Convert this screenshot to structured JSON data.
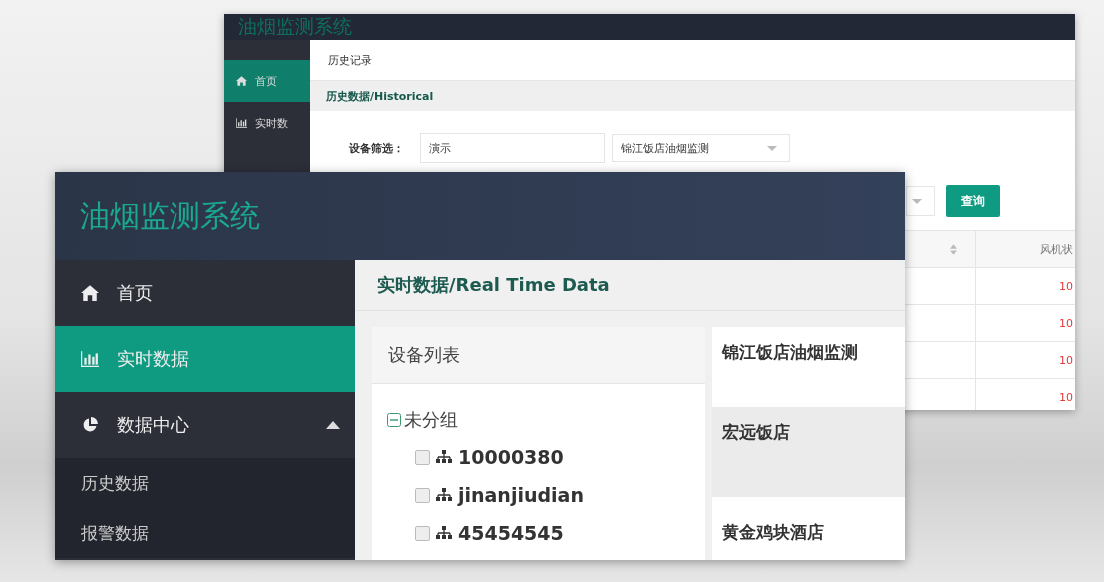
{
  "back_window": {
    "logo": "油烟监测系统",
    "nav": [
      {
        "label": "首页",
        "kind": "home",
        "selected": true
      },
      {
        "label": "实时数",
        "kind": "bars",
        "selected": false
      }
    ],
    "tab": "历史记录",
    "breadcrumb": "历史数据/Historical",
    "filter": {
      "label": "设备筛选：",
      "field_value": "演示",
      "select_value": "锦江饭店油烟监测"
    },
    "query_button": "查询",
    "table": {
      "column_2": "风机状",
      "rows": [
        "10",
        "10",
        "10",
        "10"
      ]
    }
  },
  "front_window": {
    "logo": "油烟监测系统",
    "nav": [
      {
        "label": "首页",
        "kind": "home",
        "selected": false
      },
      {
        "label": "实时数据",
        "kind": "bars",
        "selected": true
      },
      {
        "label": "数据中心",
        "kind": "pie",
        "selected": false,
        "expanded": true,
        "children": [
          {
            "label": "历史数据",
            "selected": false
          },
          {
            "label": "报警数据",
            "selected": false
          }
        ]
      }
    ],
    "breadcrumb": "实时数据/Real Time Data",
    "device_list": {
      "title": "设备列表",
      "groups": [
        {
          "label": "未分组",
          "expanded": true,
          "children": [
            {
              "label": "10000380",
              "checked": false
            },
            {
              "label": "jinanjiudian",
              "checked": false
            },
            {
              "label": "45454545",
              "checked": false
            }
          ]
        }
      ]
    },
    "device_cards": [
      {
        "name": "锦江饭店油烟监测",
        "selected": false
      },
      {
        "name": "宏远饭店",
        "selected": true
      },
      {
        "name": "黄金鸡块酒店",
        "selected": false
      }
    ]
  }
}
